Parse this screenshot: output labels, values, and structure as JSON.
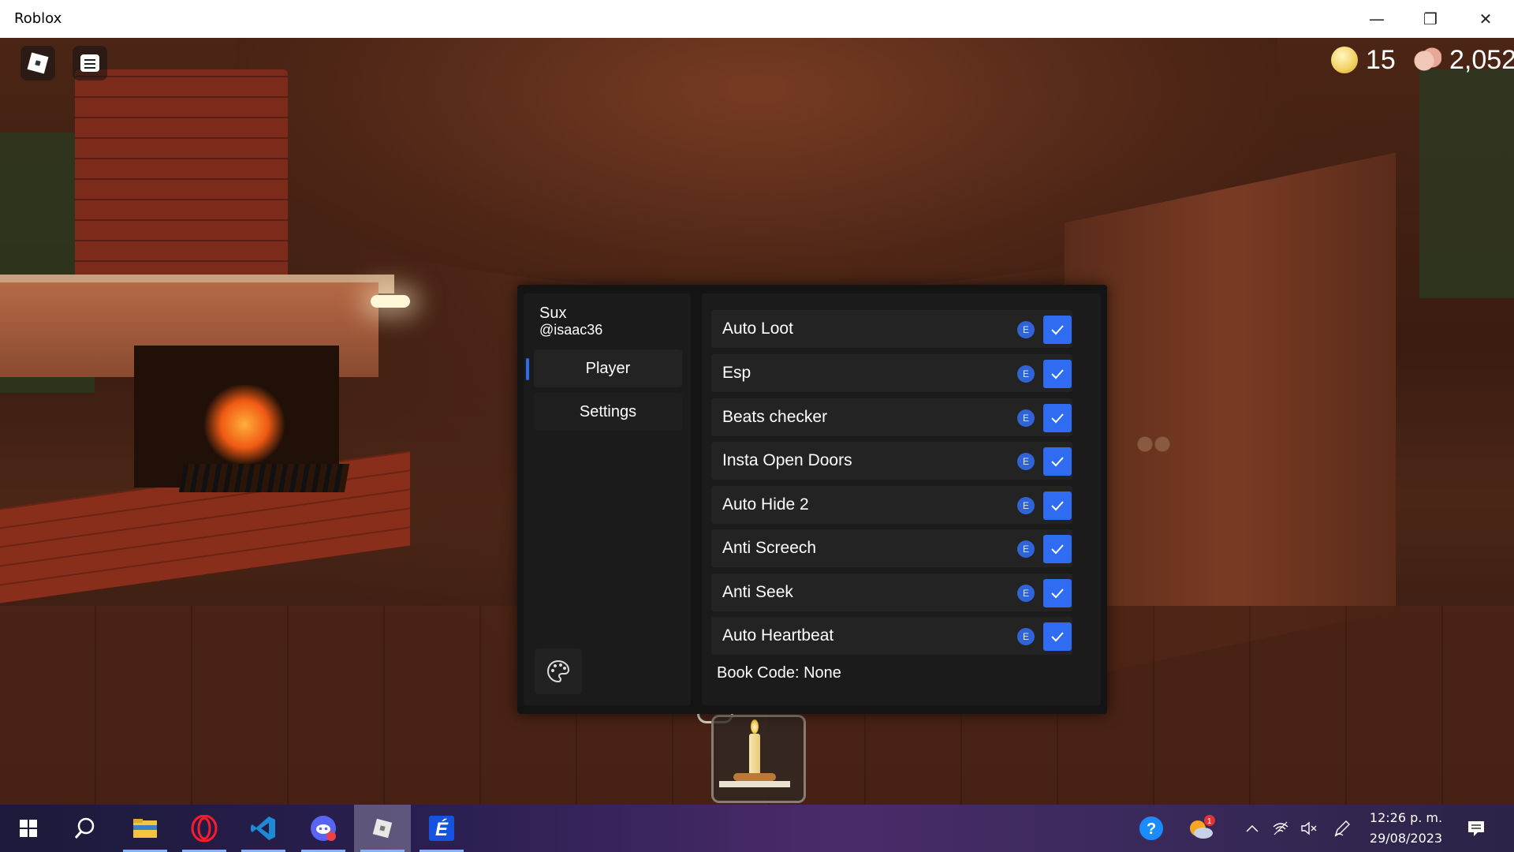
{
  "window": {
    "title": "Roblox",
    "minimize": "—",
    "restore": "❐",
    "close": "✕"
  },
  "hud": {
    "coins": "15",
    "knobs": "2,052"
  },
  "gui": {
    "user_name": "Sux",
    "user_handle": "@isaac36",
    "tabs": [
      {
        "label": "Player",
        "active": true
      },
      {
        "label": "Settings",
        "active": false
      }
    ],
    "toggles": [
      {
        "label": "Auto Loot",
        "keybind": "E",
        "checked": true
      },
      {
        "label": "Esp",
        "keybind": "E",
        "checked": true
      },
      {
        "label": "Beats checker",
        "keybind": "E",
        "checked": true
      },
      {
        "label": "Insta Open Doors",
        "keybind": "E",
        "checked": true
      },
      {
        "label": "Auto Hide 2",
        "keybind": "E",
        "checked": true
      },
      {
        "label": "Anti Screech",
        "keybind": "E",
        "checked": true
      },
      {
        "label": "Anti Seek",
        "keybind": "E",
        "checked": true
      },
      {
        "label": "Auto Heartbeat",
        "keybind": "E",
        "checked": true
      }
    ],
    "book_code": "Book Code: None",
    "accent_color": "#2f6cf2"
  },
  "taskbar": {
    "apps": [
      "windows-start",
      "search",
      "file-explorer",
      "opera",
      "vscode",
      "discord",
      "roblox",
      "exploit-app"
    ],
    "weather_badge": "1",
    "time": "12:26 p. m.",
    "date": "29/08/2023"
  }
}
